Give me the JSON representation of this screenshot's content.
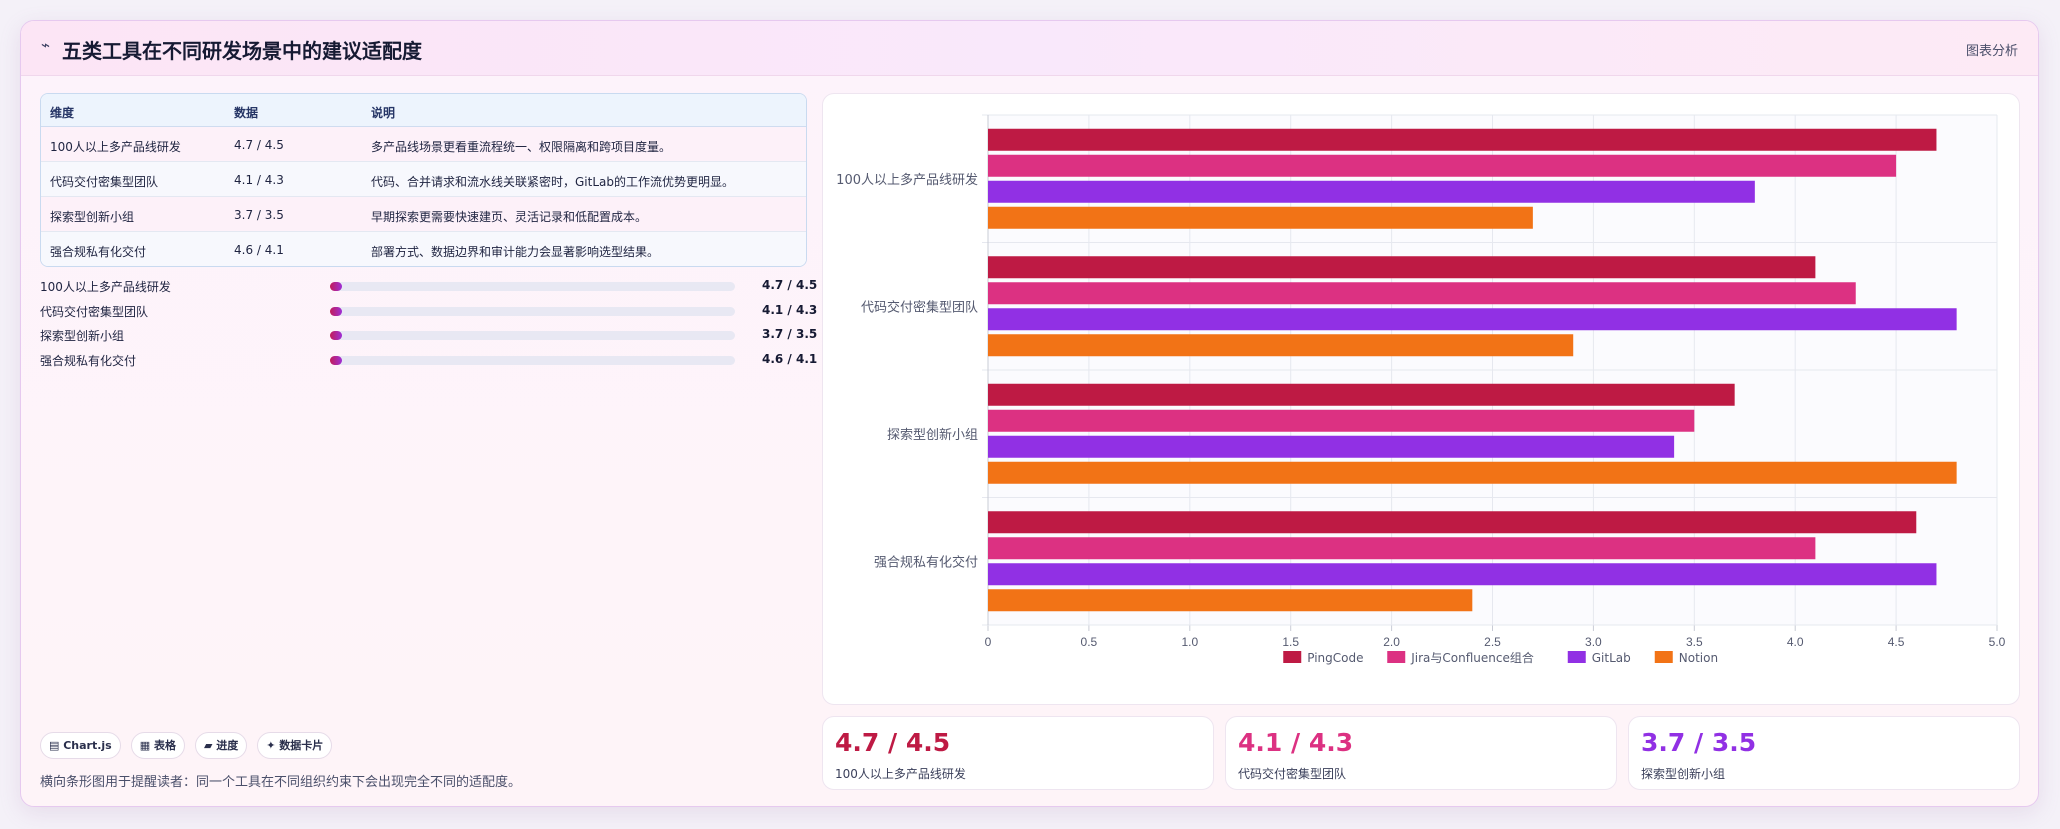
{
  "header": {
    "icon": "chart-line-icon",
    "title": "五类工具在不同研发场景中的建议适配度",
    "link": "图表分析"
  },
  "table": {
    "headers": [
      "维度",
      "数据",
      "说明"
    ],
    "rows": [
      [
        "100人以上多产品线研发",
        "4.7 / 4.5",
        "多产品线场景更看重流程统一、权限隔离和跨项目度量。"
      ],
      [
        "代码交付密集型团队",
        "4.1 / 4.3",
        "代码、合并请求和流水线关联紧密时，GitLab的工作流优势更明显。"
      ],
      [
        "探索型创新小组",
        "3.7 / 3.5",
        "早期探索更需要快速建页、灵活记录和低配置成本。"
      ],
      [
        "强合规私有化交付",
        "4.6 / 4.1",
        "部署方式、数据边界和审计能力会显著影响选型结果。"
      ]
    ]
  },
  "progress": [
    {
      "label": "100人以上多产品线研发",
      "value": "4.7 / 4.5",
      "fill": 0.03
    },
    {
      "label": "代码交付密集型团队",
      "value": "4.1 / 4.3",
      "fill": 0.03
    },
    {
      "label": "探索型创新小组",
      "value": "3.7 / 3.5",
      "fill": 0.03
    },
    {
      "label": "强合规私有化交付",
      "value": "4.6 / 4.1",
      "fill": 0.03
    }
  ],
  "chips": [
    "▤ Chart.js",
    "▦ 表格",
    "▰ 进度",
    "✦ 数据卡片"
  ],
  "footnote": "横向条形图用于提醒读者：同一个工具在不同组织约束下会出现完全不同的适配度。",
  "chart_data": {
    "type": "bar",
    "orientation": "horizontal",
    "categories": [
      "100人以上多产品线研发",
      "代码交付密集型团队",
      "探索型创新小组",
      "强合规私有化交付"
    ],
    "series": [
      {
        "name": "PingCode",
        "color": "#be1a44",
        "values": [
          4.7,
          4.1,
          3.7,
          4.6
        ]
      },
      {
        "name": "Jira与Confluence组合",
        "color": "#dc3182",
        "values": [
          4.5,
          4.3,
          3.5,
          4.1
        ]
      },
      {
        "name": "GitLab",
        "color": "#9130e4",
        "values": [
          3.8,
          4.8,
          3.4,
          4.7
        ]
      },
      {
        "name": "Notion",
        "color": "#f27316",
        "values": [
          2.7,
          2.9,
          4.8,
          2.4
        ]
      }
    ],
    "xlim": [
      0,
      5
    ],
    "xticks": [
      "0",
      "0.5",
      "1.0",
      "1.5",
      "2.0",
      "2.5",
      "3.0",
      "3.5",
      "4.0",
      "4.5",
      "5.0"
    ],
    "grid": true,
    "legend": "bottom"
  },
  "kpis": [
    {
      "value": "4.7 / 4.5",
      "label": "100人以上多产品线研发",
      "color": "#be1a44"
    },
    {
      "value": "4.1 / 4.3",
      "label": "代码交付密集型团队",
      "color": "#dc3182"
    },
    {
      "value": "3.7 / 3.5",
      "label": "探索型创新小组",
      "color": "#9130e4"
    }
  ]
}
